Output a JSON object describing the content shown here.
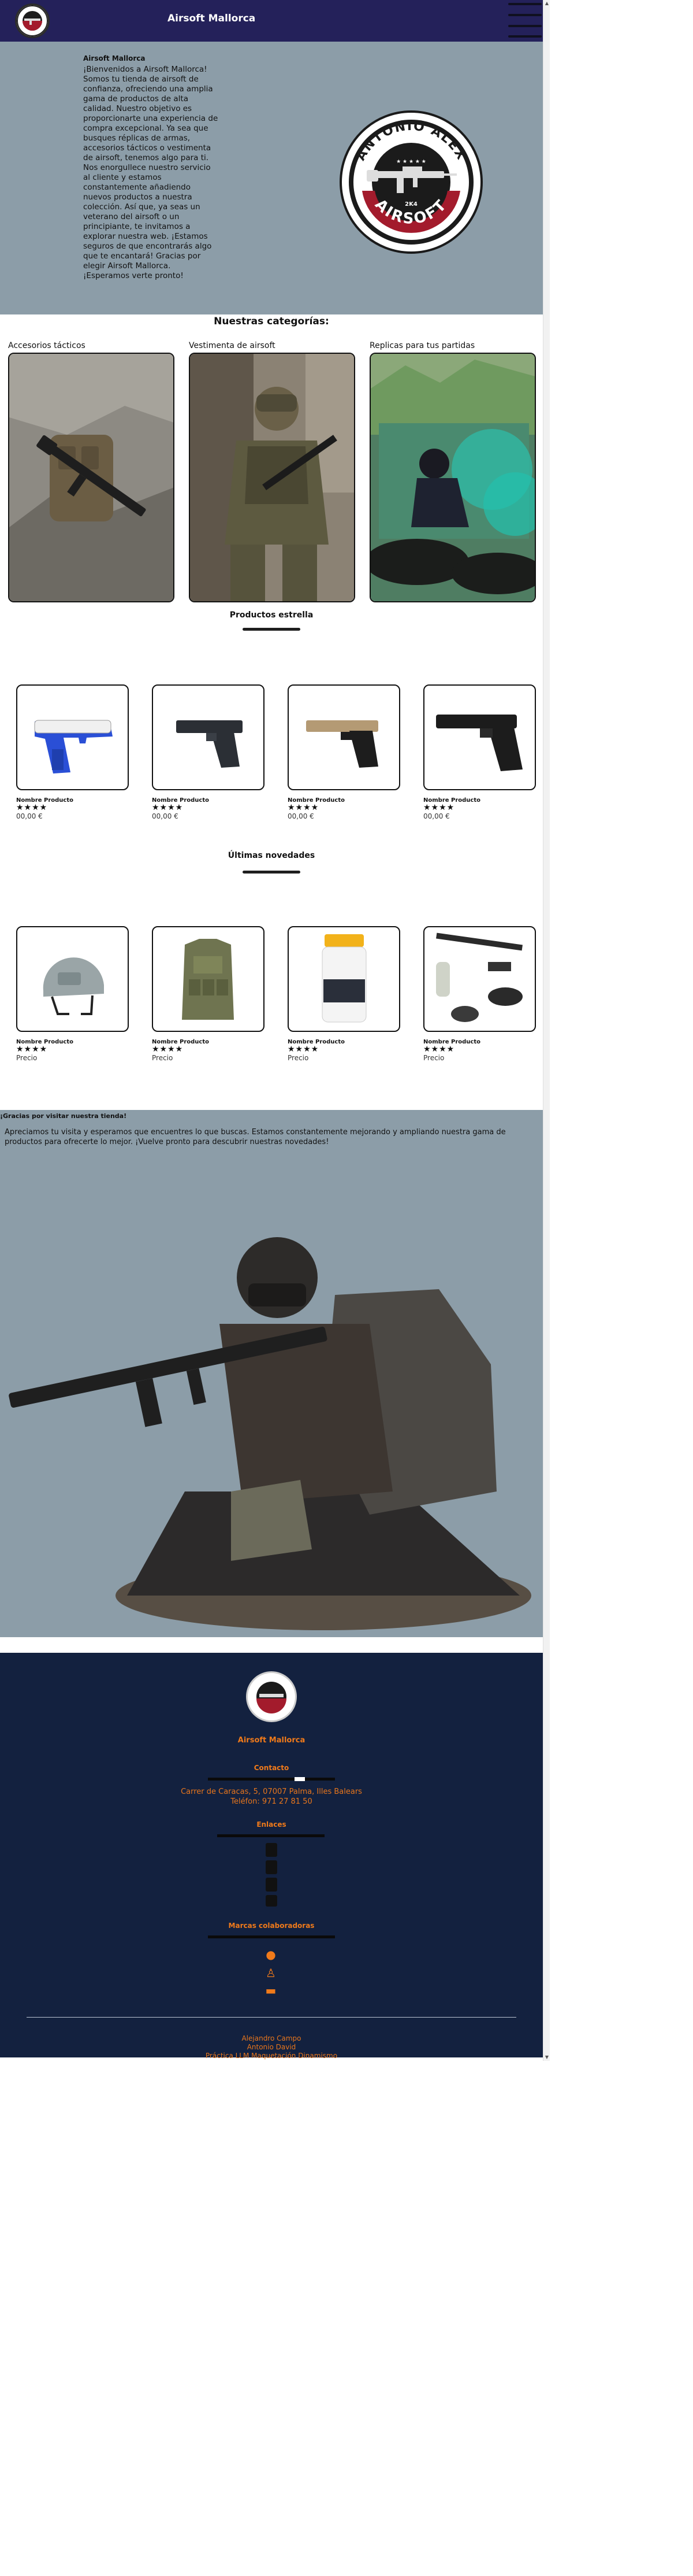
{
  "header": {
    "title": "Airsoft Mallorca",
    "logo_icon": "airsoft-logo-icon",
    "menu_icon": "hamburger-menu-icon",
    "bg_color": "#24215a"
  },
  "hero": {
    "title": "Airsoft Mallorca",
    "text": "¡Bienvenidos a Airsoft Mallorca! Somos tu tienda de airsoft de confianza, ofreciendo una amplia gama de productos de alta calidad. Nuestro objetivo es proporcionarte una experiencia de compra excepcional. Ya sea que busques réplicas de armas, accesorios tácticos o vestimenta de airsoft, tenemos algo para ti. Nos enorgullece nuestro servicio al cliente y estamos constantemente añadiendo nuevos productos a nuestra colección. Así que, ya seas un veterano del airsoft o un principiante, te invitamos a explorar nuestra web. ¡Estamos seguros de que encontrarás algo que te encantará! Gracias por elegir Airsoft Mallorca. ¡Esperamos verte pronto!",
    "logo": {
      "top_text": "ANTONIO ALEX",
      "bottom_text": "AIRSOFT",
      "stars": "★ ★ ★ ★ ★",
      "year": "2K4"
    },
    "bg_color": "#8c9da8"
  },
  "categories": {
    "title": "Nuestras categorías:",
    "items": [
      {
        "label": "Accesorios tácticos"
      },
      {
        "label": "Vestimenta de airsoft"
      },
      {
        "label": "Replicas para tus partidas"
      }
    ]
  },
  "featured": {
    "title": "Productos estrella",
    "products": [
      {
        "name": "Nombre Producto",
        "stars": "★★★★",
        "price": "00,00 €",
        "icon": "blue-pistol-icon"
      },
      {
        "name": "Nombre Producto",
        "stars": "★★★★",
        "price": "00,00 €",
        "icon": "black-pistol-icon"
      },
      {
        "name": "Nombre Producto",
        "stars": "★★★★",
        "price": "00,00 €",
        "icon": "tan-pistol-icon"
      },
      {
        "name": "Nombre Producto",
        "stars": "★★★★",
        "price": "00,00 €",
        "icon": "beretta-pistol-icon"
      }
    ]
  },
  "latest": {
    "title": "Últimas novedades",
    "products": [
      {
        "name": "Nombre Producto",
        "stars": "★★★★",
        "price": "Precio",
        "icon": "helmet-icon"
      },
      {
        "name": "Nombre Producto",
        "stars": "★★★★",
        "price": "Precio",
        "icon": "tactical-vest-icon"
      },
      {
        "name": "Nombre Producto",
        "stars": "★★★★",
        "price": "Precio",
        "icon": "bb-jar-icon"
      },
      {
        "name": "Nombre Producto",
        "stars": "★★★★",
        "price": "Precio",
        "icon": "gear-kit-icon"
      }
    ]
  },
  "thanks": {
    "title": "¡Gracias por visitar nuestra tienda!",
    "text": "Apreciamos tu visita y esperamos que encuentres lo que buscas. Estamos constantemente mejorando y ampliando nuestra gama de productos para ofrecerte lo mejor. ¡Vuelve pronto para descubrir nuestras novedades!"
  },
  "footer": {
    "brand": "Airsoft Mallorca",
    "contact_title": "Contacto",
    "address": "Carrer de Caracas, 5, 07007 Palma, Illes Balears",
    "phone": "Teléfon: 971 27 81 50",
    "links_title": "Enlaces",
    "partners_title": "Marcas colaboradoras",
    "credits": [
      "Alejandro Campo",
      "Antonio David",
      "Práctica LLM Maquetación Dinamismo"
    ],
    "accent_color": "#f07a1a",
    "bg_color": "#13213f"
  }
}
